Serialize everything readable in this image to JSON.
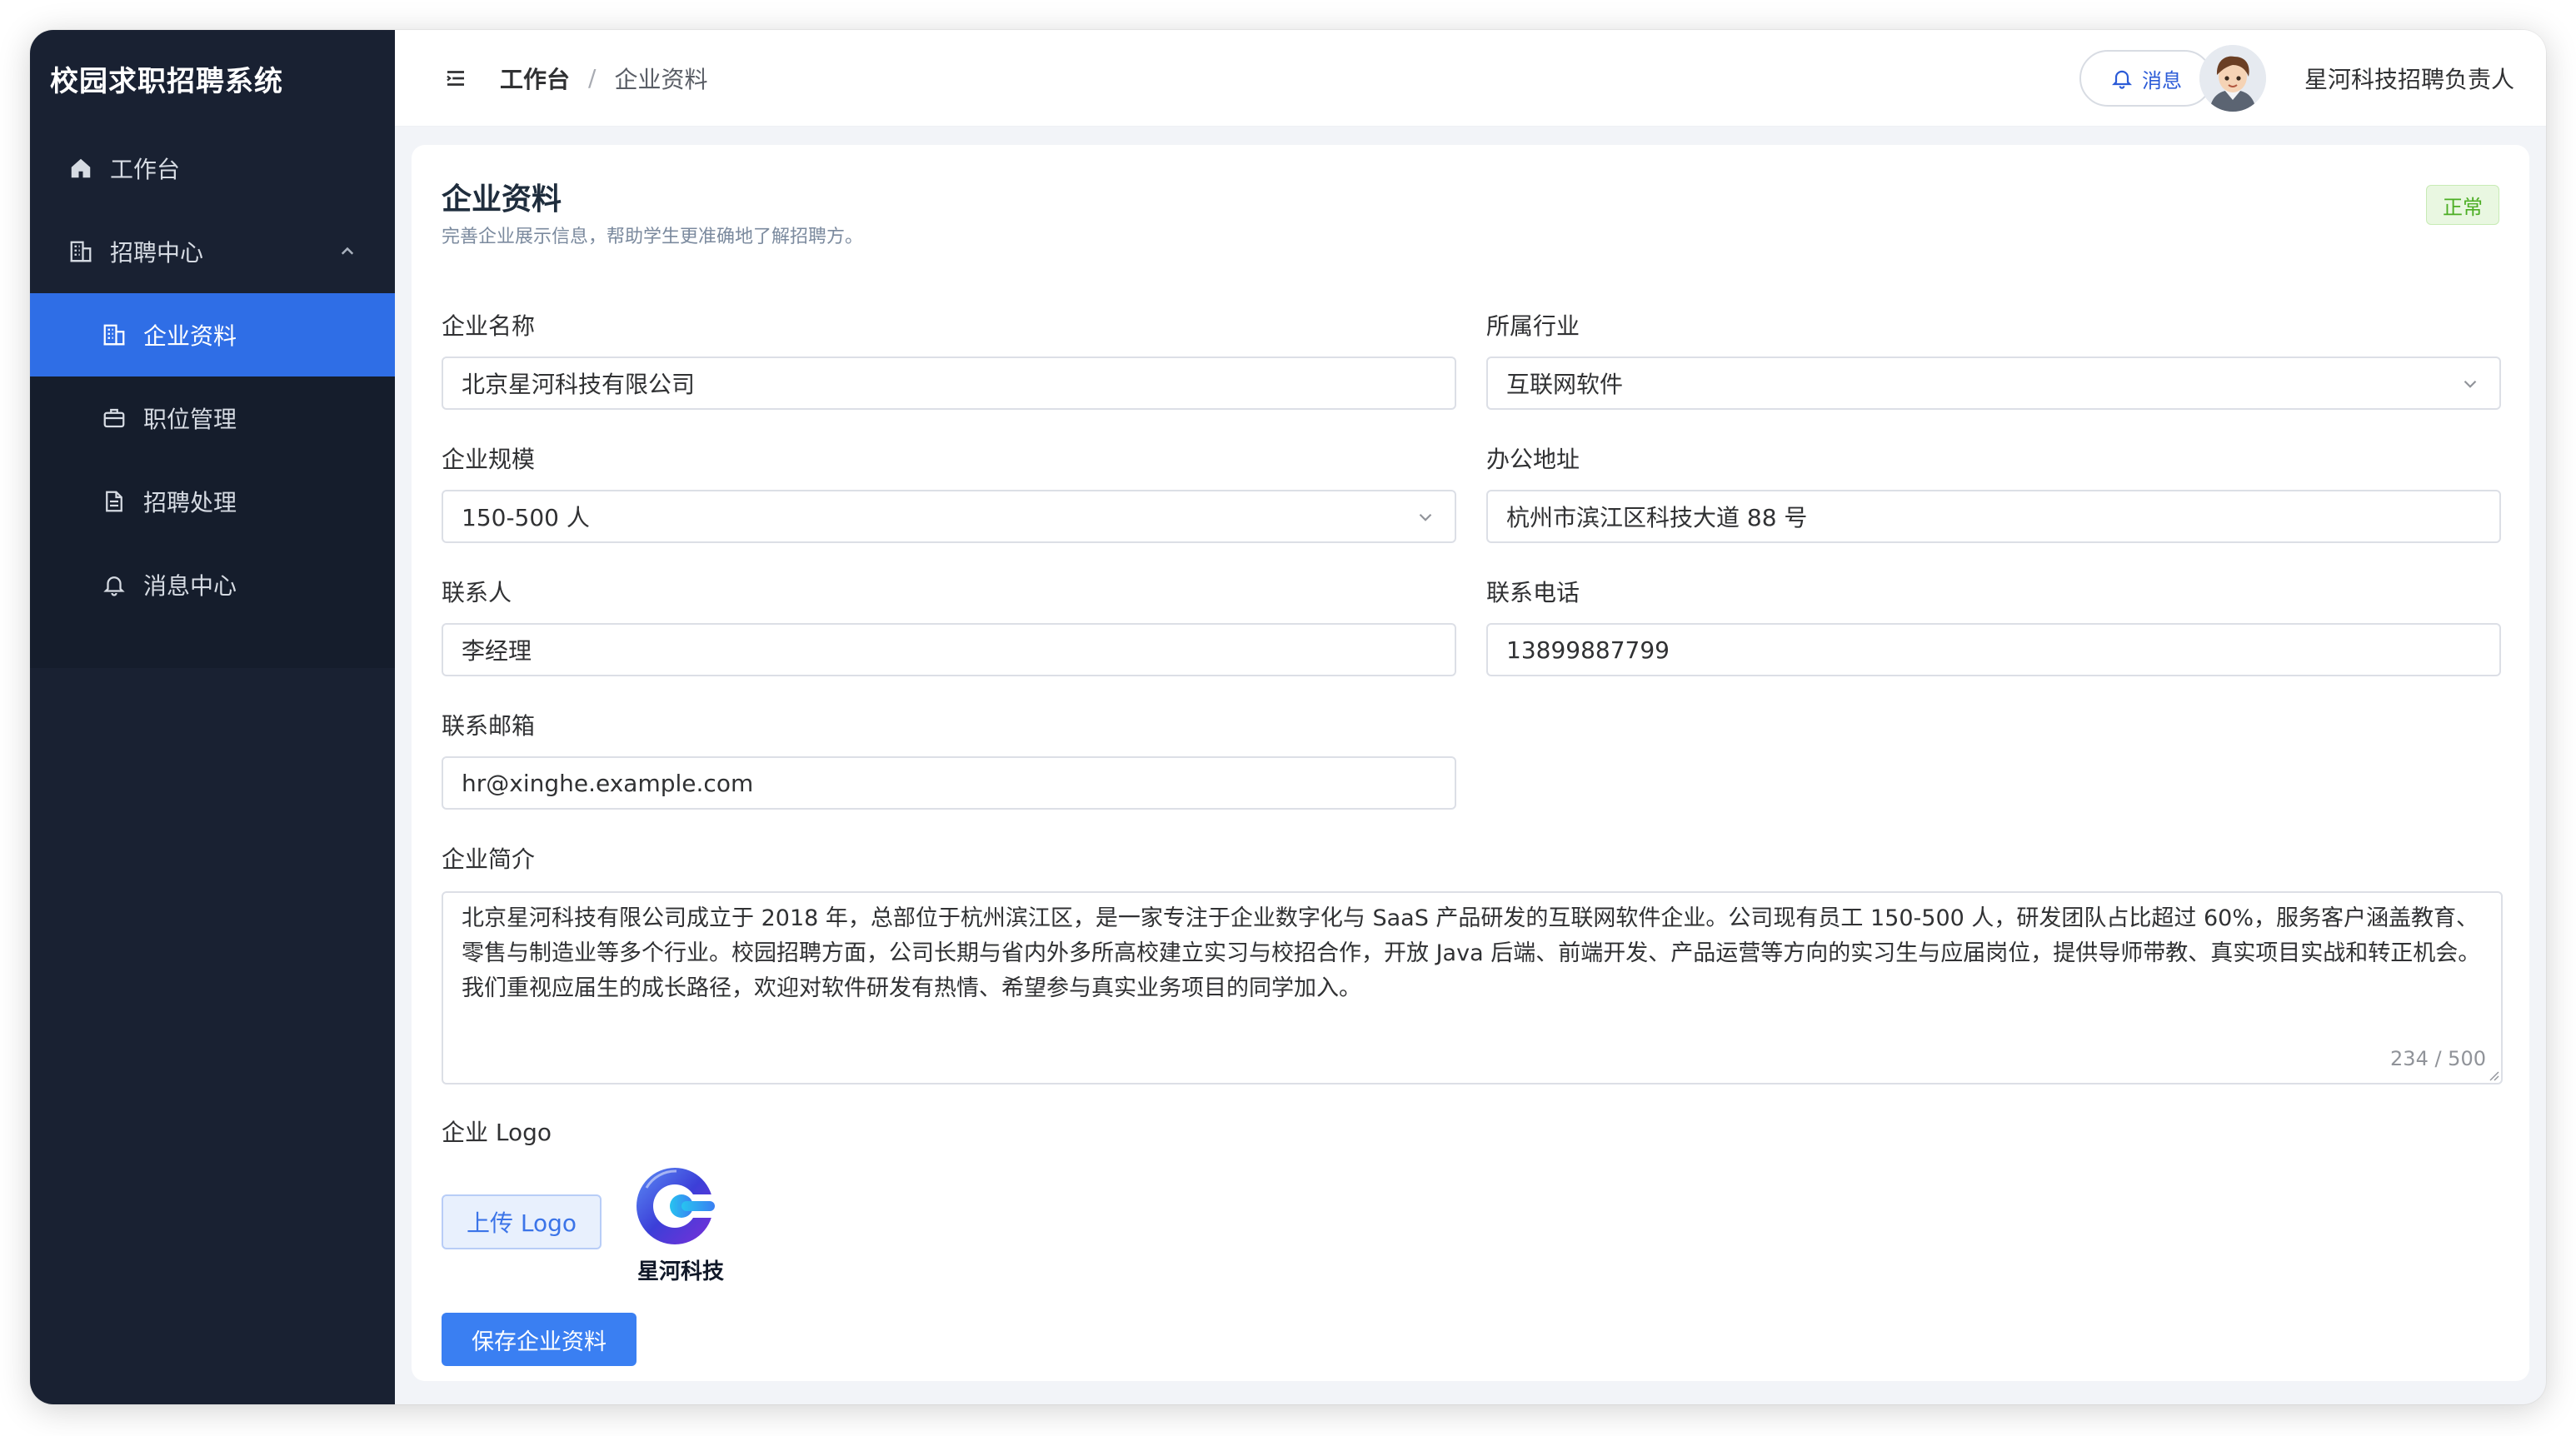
{
  "app": {
    "title": "校园求职招聘系统"
  },
  "sidebar": {
    "items": [
      {
        "label": "工作台",
        "icon": "home-icon"
      },
      {
        "label": "招聘中心",
        "icon": "building-icon",
        "expanded": true
      },
      {
        "label": "企业资料",
        "icon": "building-icon",
        "active": true
      },
      {
        "label": "职位管理",
        "icon": "briefcase-icon"
      },
      {
        "label": "招聘处理",
        "icon": "document-icon"
      },
      {
        "label": "消息中心",
        "icon": "bell-icon"
      }
    ]
  },
  "header": {
    "breadcrumb": [
      "工作台",
      "企业资料"
    ],
    "separator": "/",
    "message_label": "消息",
    "user_name": "星河科技招聘负责人"
  },
  "page": {
    "title": "企业资料",
    "subtitle": "完善企业展示信息，帮助学生更准确地了解招聘方。",
    "status": "正常",
    "status_color": "#4cae24"
  },
  "form": {
    "company_name": {
      "label": "企业名称",
      "value": "北京星河科技有限公司"
    },
    "industry": {
      "label": "所属行业",
      "value": "互联网软件"
    },
    "scale": {
      "label": "企业规模",
      "value": "150-500 人"
    },
    "address": {
      "label": "办公地址",
      "value": "杭州市滨江区科技大道 88 号"
    },
    "contact": {
      "label": "联系人",
      "value": "李经理"
    },
    "phone": {
      "label": "联系电话",
      "value": "13899887799"
    },
    "email": {
      "label": "联系邮箱",
      "value": "hr@xinghe.example.com"
    },
    "intro": {
      "label": "企业简介",
      "value": "北京星河科技有限公司成立于 2018 年，总部位于杭州滨江区，是一家专注于企业数字化与 SaaS 产品研发的互联网软件企业。公司现有员工 150-500 人，研发团队占比超过 60%，服务客户涵盖教育、零售与制造业等多个行业。校园招聘方面，公司长期与省内外多所高校建立实习与校招合作，开放 Java 后端、前端开发、产品运营等方向的实习生与应届岗位，提供导师带教、真实项目实战和转正机会。我们重视应届生的成长路径，欢迎对软件研发有热情、希望参与真实业务项目的同学加入。",
      "counter": "234 / 500"
    },
    "logo": {
      "label": "企业 Logo",
      "upload_label": "上传 Logo",
      "logo_text": "星河科技"
    },
    "save_label": "保存企业资料"
  },
  "colors": {
    "sidebar_bg": "#192132",
    "accent": "#2f6ee6",
    "primary_button": "#3a7ff2"
  }
}
